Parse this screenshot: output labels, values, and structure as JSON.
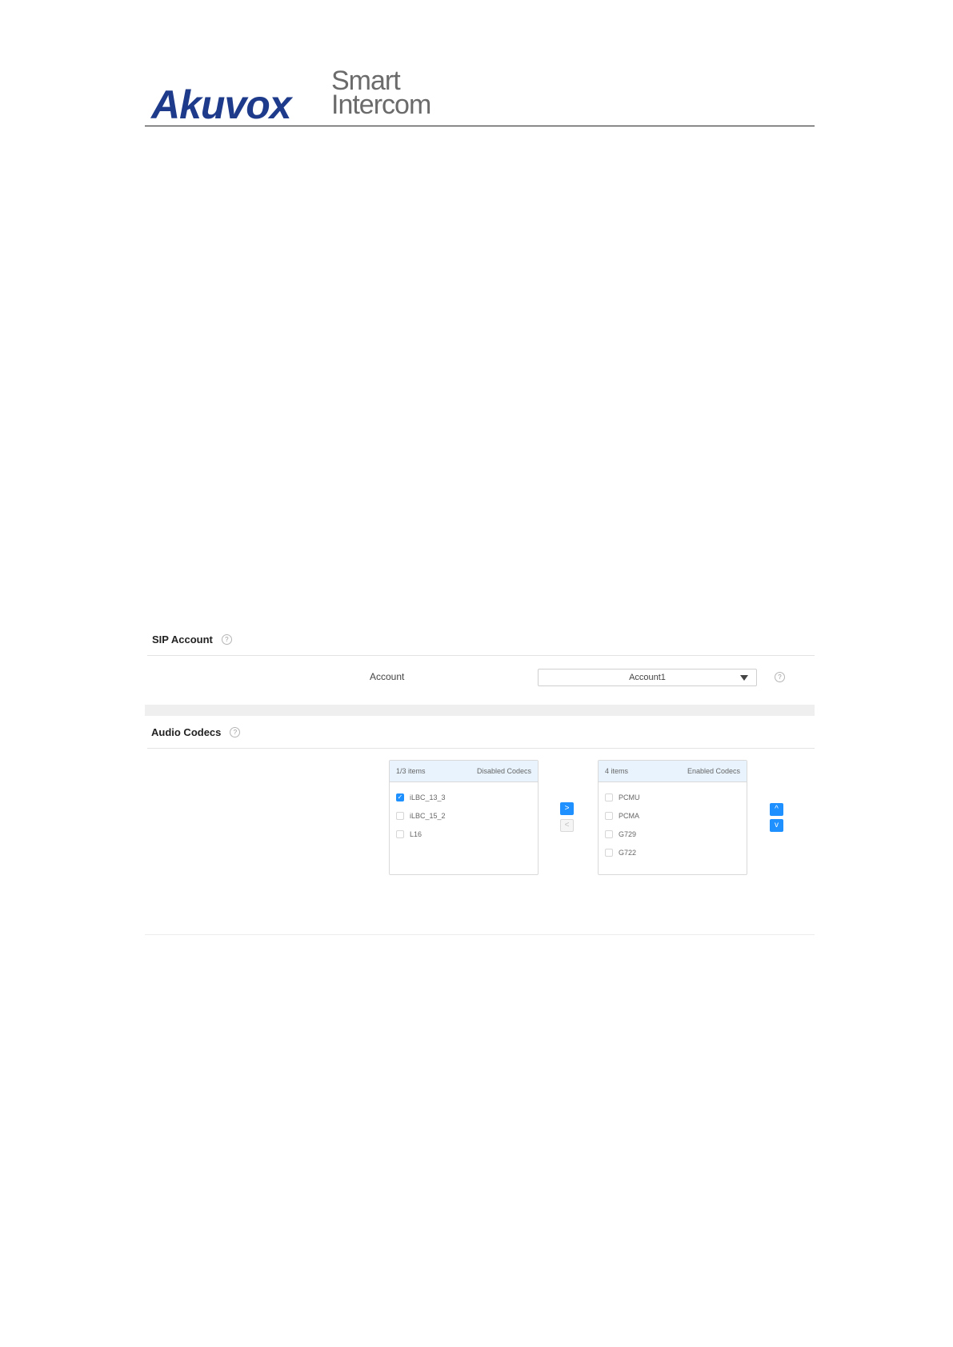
{
  "header": {
    "logo_main": "Akuvox",
    "logo_sub_line1": "Smart",
    "logo_sub_line2": "Intercom"
  },
  "sip_account": {
    "title": "SIP Account",
    "account_label": "Account",
    "account_value": "Account1"
  },
  "audio_codecs": {
    "title": "Audio Codecs",
    "disabled": {
      "count_label": "1/3 items",
      "title": "Disabled Codecs",
      "items": [
        {
          "label": "iLBC_13_3",
          "checked": true
        },
        {
          "label": "iLBC_15_2",
          "checked": false
        },
        {
          "label": "L16",
          "checked": false
        }
      ]
    },
    "enabled": {
      "count_label": "4 items",
      "title": "Enabled Codecs",
      "items": [
        {
          "label": "PCMU",
          "checked": false
        },
        {
          "label": "PCMA",
          "checked": false
        },
        {
          "label": "G729",
          "checked": false
        },
        {
          "label": "G722",
          "checked": false
        }
      ]
    },
    "buttons": {
      "move_right": ">",
      "move_left": "<",
      "move_up": "^",
      "move_down": "v"
    }
  },
  "icons": {
    "help": "?",
    "check": "✓"
  },
  "colors": {
    "brand": "#1e3a8a",
    "accent": "#1e90ff",
    "panel_header": "#e8f3fd"
  }
}
